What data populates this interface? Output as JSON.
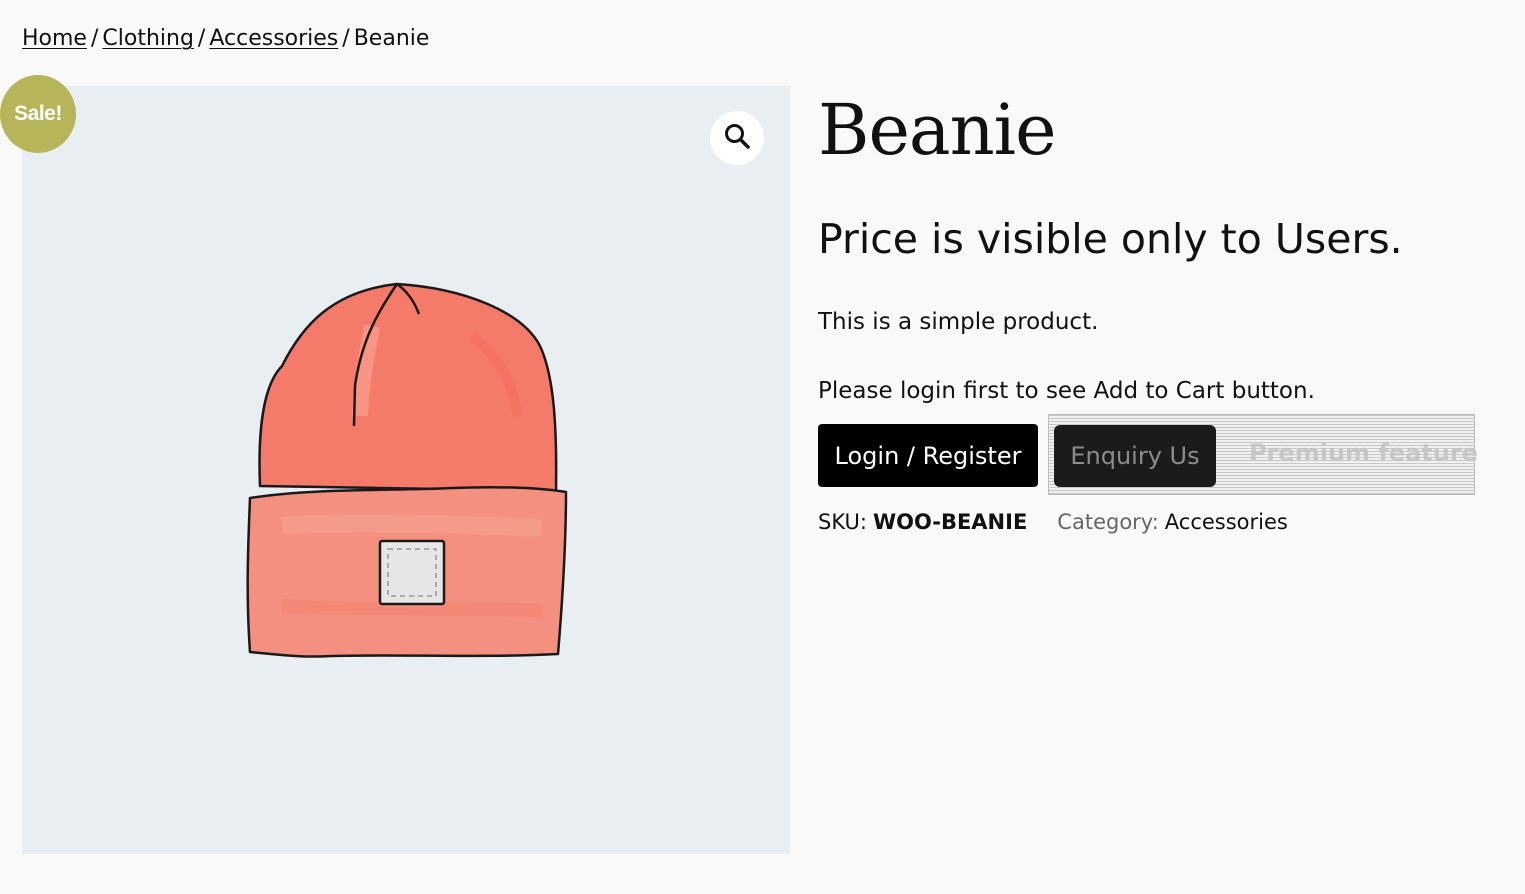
{
  "breadcrumb": {
    "items": [
      {
        "label": "Home"
      },
      {
        "label": "Clothing"
      },
      {
        "label": "Accessories"
      }
    ],
    "separator": "/",
    "current": "Beanie"
  },
  "badge": {
    "label": "Sale!",
    "color": "#b6b55a"
  },
  "gallery": {
    "zoom_icon": "magnifier-icon",
    "image_subject": "beanie"
  },
  "product": {
    "title": "Beanie",
    "price_notice": "Price is visible only to Users.",
    "short_description": "This is a simple product.",
    "login_notice": "Please login first to see Add to Cart button.",
    "login_button": "Login / Register",
    "enquiry_button": "Enquiry Us",
    "premium_label": "Premium feature",
    "sku_label": "SKU:",
    "sku_value": "WOO-BEANIE",
    "category_label": "Category:",
    "category_value": "Accessories"
  }
}
